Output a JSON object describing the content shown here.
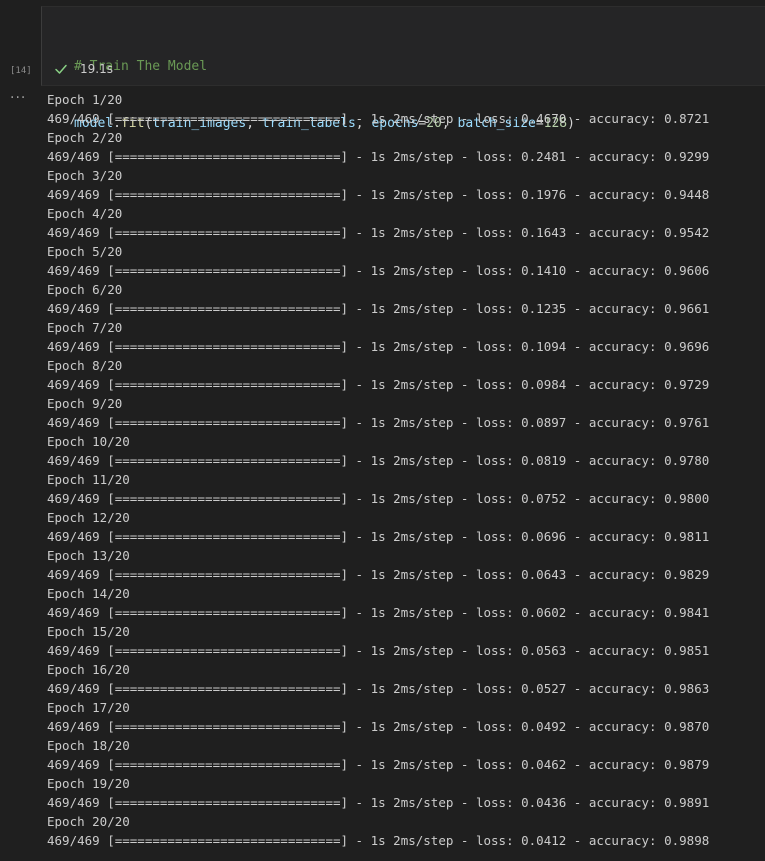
{
  "cell": {
    "execution_count": "[14]",
    "status_time": "19.1s",
    "code": {
      "comment": "# Train The Model",
      "model": "model",
      "fit": "fit",
      "open": "(",
      "arg1": "train_images",
      "sep1": ", ",
      "arg2": "train_labels",
      "sep2": ", ",
      "kw1": "epochs",
      "eq1": "=",
      "val1": "20",
      "sep3": ", ",
      "kw2": "batch_size",
      "eq2": "=",
      "val2": "128",
      "close": ")"
    }
  },
  "output": {
    "more_label": "···",
    "lines": [
      "Epoch 1/20",
      "469/469 [==============================] - 1s 2ms/step - loss: 0.4670 - accuracy: 0.8721",
      "Epoch 2/20",
      "469/469 [==============================] - 1s 2ms/step - loss: 0.2481 - accuracy: 0.9299",
      "Epoch 3/20",
      "469/469 [==============================] - 1s 2ms/step - loss: 0.1976 - accuracy: 0.9448",
      "Epoch 4/20",
      "469/469 [==============================] - 1s 2ms/step - loss: 0.1643 - accuracy: 0.9542",
      "Epoch 5/20",
      "469/469 [==============================] - 1s 2ms/step - loss: 0.1410 - accuracy: 0.9606",
      "Epoch 6/20",
      "469/469 [==============================] - 1s 2ms/step - loss: 0.1235 - accuracy: 0.9661",
      "Epoch 7/20",
      "469/469 [==============================] - 1s 2ms/step - loss: 0.1094 - accuracy: 0.9696",
      "Epoch 8/20",
      "469/469 [==============================] - 1s 2ms/step - loss: 0.0984 - accuracy: 0.9729",
      "Epoch 9/20",
      "469/469 [==============================] - 1s 2ms/step - loss: 0.0897 - accuracy: 0.9761",
      "Epoch 10/20",
      "469/469 [==============================] - 1s 2ms/step - loss: 0.0819 - accuracy: 0.9780",
      "Epoch 11/20",
      "469/469 [==============================] - 1s 2ms/step - loss: 0.0752 - accuracy: 0.9800",
      "Epoch 12/20",
      "469/469 [==============================] - 1s 2ms/step - loss: 0.0696 - accuracy: 0.9811",
      "Epoch 13/20",
      "469/469 [==============================] - 1s 2ms/step - loss: 0.0643 - accuracy: 0.9829",
      "Epoch 14/20",
      "469/469 [==============================] - 1s 2ms/step - loss: 0.0602 - accuracy: 0.9841",
      "Epoch 15/20",
      "469/469 [==============================] - 1s 2ms/step - loss: 0.0563 - accuracy: 0.9851",
      "Epoch 16/20",
      "469/469 [==============================] - 1s 2ms/step - loss: 0.0527 - accuracy: 0.9863",
      "Epoch 17/20",
      "469/469 [==============================] - 1s 2ms/step - loss: 0.0492 - accuracy: 0.9870",
      "Epoch 18/20",
      "469/469 [==============================] - 1s 2ms/step - loss: 0.0462 - accuracy: 0.9879",
      "Epoch 19/20",
      "469/469 [==============================] - 1s 2ms/step - loss: 0.0436 - accuracy: 0.9891",
      "Epoch 20/20",
      "469/469 [==============================] - 1s 2ms/step - loss: 0.0412 - accuracy: 0.9898"
    ]
  },
  "icons": {
    "status": "check-icon",
    "output_menu": "more-icon"
  },
  "colors": {
    "background": "#1f1f1f",
    "cell_background": "#252526",
    "success": "#89d185",
    "comment": "#6a9955",
    "variable": "#9cdcfe",
    "function": "#dcdcaa",
    "number": "#b5cea8"
  }
}
